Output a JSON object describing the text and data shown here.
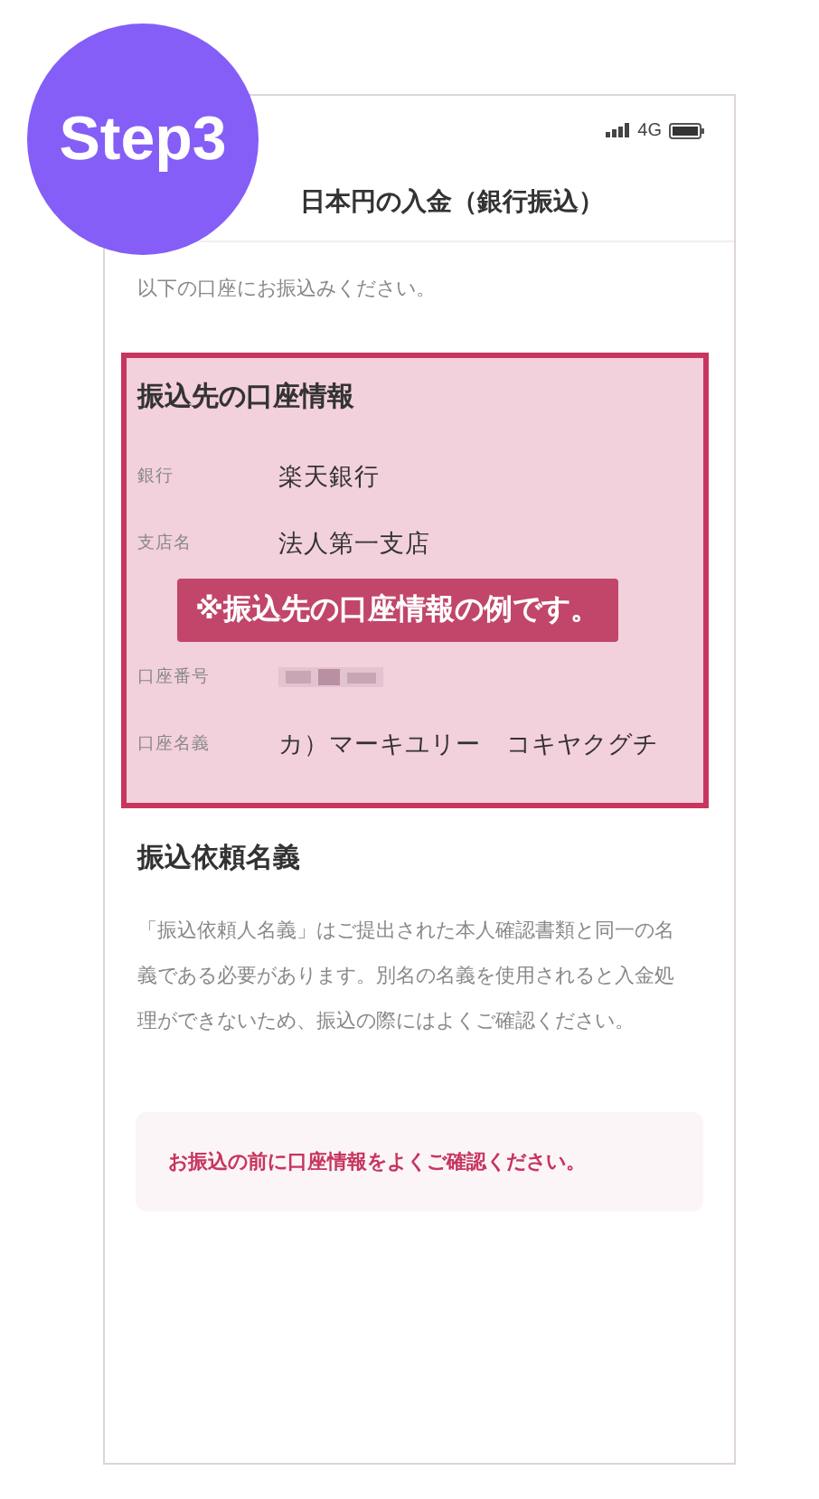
{
  "badge": {
    "label": "Step3"
  },
  "status_bar": {
    "network": "4G"
  },
  "header": {
    "title": "日本円の入金（銀行振込）"
  },
  "intro": "以下の口座にお振込みください。",
  "account_card": {
    "title": "振込先の口座情報",
    "rows": [
      {
        "label": "銀行",
        "value": "楽天銀行",
        "kind": "text"
      },
      {
        "label": "支店名",
        "value": "法人第一支店",
        "kind": "text"
      },
      {
        "label": "口座番号",
        "kind": "redacted"
      },
      {
        "label": "口座名義",
        "value": "カ）マーキユリー　コキヤクグチ",
        "kind": "text"
      }
    ],
    "overlay": "※振込先の口座情報の例です。"
  },
  "name_section": {
    "title": "振込依頼名義",
    "body": "「振込依頼人名義」はご提出された本人確認書類と同一の名義である必要があります。別名の名義を使用されると入金処理ができないため、振込の際にはよくご確認ください。"
  },
  "notice": "お振込の前に口座情報をよくご確認ください。"
}
